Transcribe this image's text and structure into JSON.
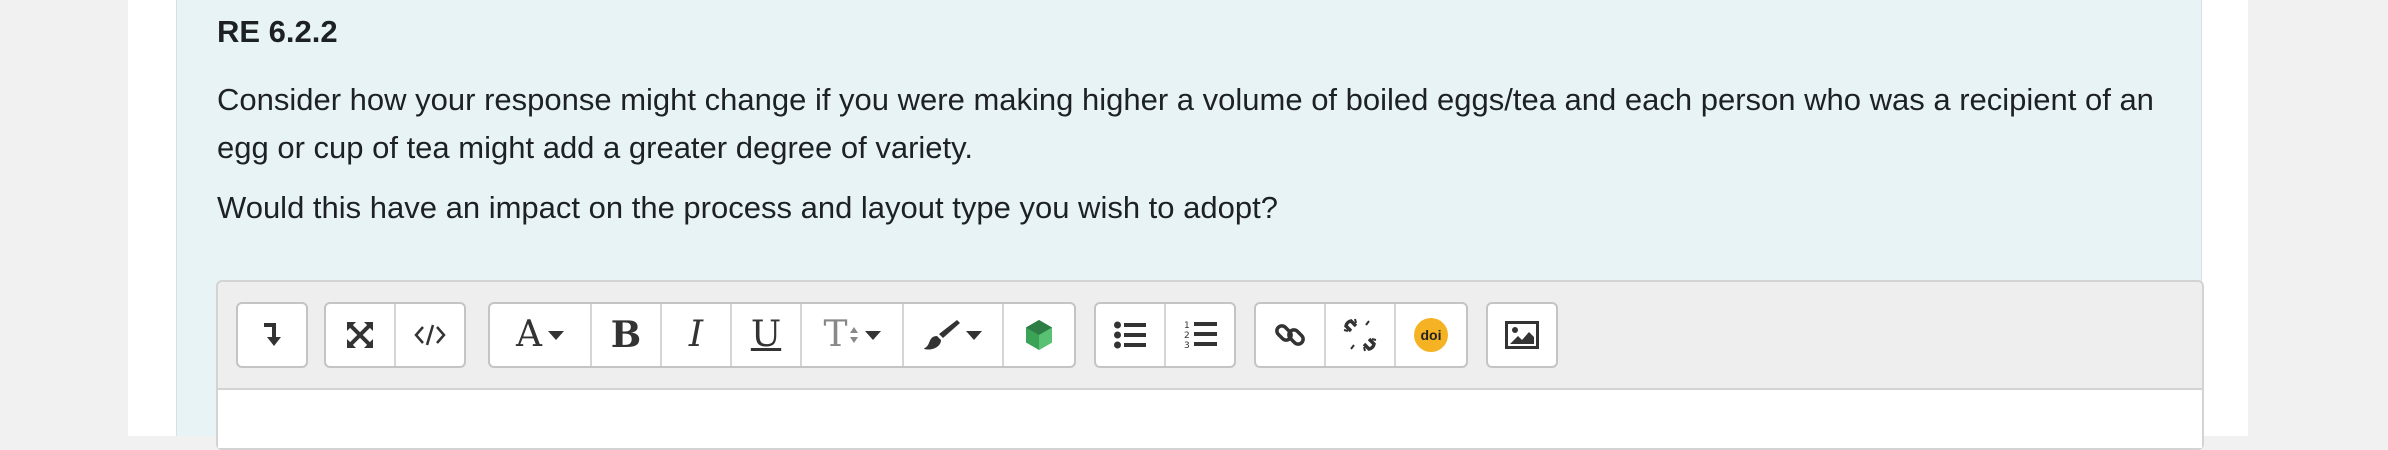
{
  "question": {
    "title": "RE 6.2.2",
    "paragraph1": "Consider how your response might change if you were making higher a volume of boiled eggs/tea and each person who was a recipient of an egg or cup of tea might add a greater degree of variety.",
    "paragraph2": "Would this have an impact on the process and layout type you wish to adopt?"
  },
  "toolbar": {
    "bold_glyph": "B",
    "italic_glyph": "I",
    "underline_glyph": "U",
    "font_glyph": "A",
    "size_glyph": "T",
    "doi_label": "doi",
    "icons": [
      "toggle-toolbar-icon",
      "fullscreen-icon",
      "html-source-icon",
      "font-family-icon",
      "bold-icon",
      "italic-icon",
      "underline-icon",
      "font-size-icon",
      "text-color-icon",
      "h5p-icon",
      "bullet-list-icon",
      "numbered-list-icon",
      "link-icon",
      "unlink-icon",
      "doi-icon",
      "image-icon"
    ]
  },
  "colors": {
    "question_bg": "#e7f3f5",
    "h5p_green": "#3aa356",
    "doi_yellow": "#f5b324"
  }
}
